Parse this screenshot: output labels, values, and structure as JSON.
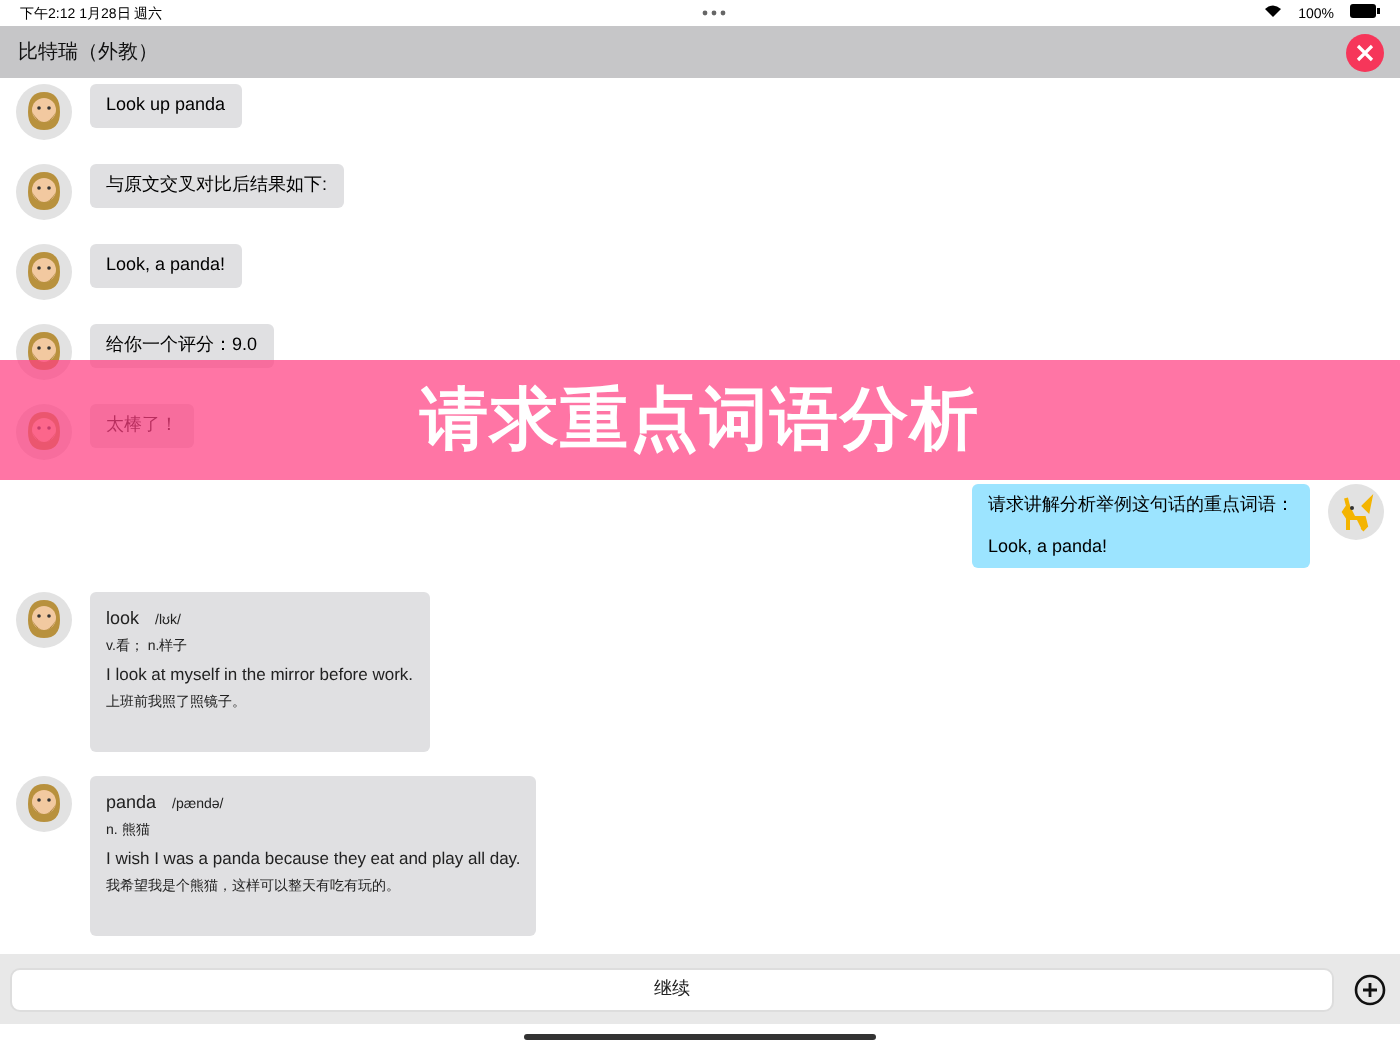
{
  "status_bar": {
    "time": "下午2:12",
    "date": "1月28日 週六",
    "battery": "100%"
  },
  "title_bar": {
    "title": "比特瑞（外教）"
  },
  "messages": [
    {
      "outgoing": false,
      "kind": "text",
      "text": "Look up panda"
    },
    {
      "outgoing": false,
      "kind": "text",
      "text": "与原文交叉对比后结果如下:"
    },
    {
      "outgoing": false,
      "kind": "text",
      "text": "Look, a panda!"
    },
    {
      "outgoing": false,
      "kind": "text",
      "text": "给你一个评分：9.0"
    },
    {
      "outgoing": false,
      "kind": "text",
      "text": "太棒了！"
    },
    {
      "outgoing": true,
      "kind": "text",
      "text": "请求讲解分析举例这句话的重点词语：",
      "text2": "Look, a panda!"
    },
    {
      "outgoing": false,
      "kind": "word",
      "word": "look",
      "phonetic": "/lʊk/",
      "meaning": "v.看；  n.样子",
      "example": "I look at myself in the mirror before work.",
      "translation": "上班前我照了照镜子。"
    },
    {
      "outgoing": false,
      "kind": "word",
      "word": "panda",
      "phonetic": "/pændə/",
      "meaning": "n. 熊猫",
      "example": "I wish I was a panda because they eat and play all day.",
      "translation": "我希望我是个熊猫，这样可以整天有吃有玩的。"
    }
  ],
  "banner": {
    "text": "请求重点词语分析"
  },
  "input_bar": {
    "button": "继续"
  }
}
